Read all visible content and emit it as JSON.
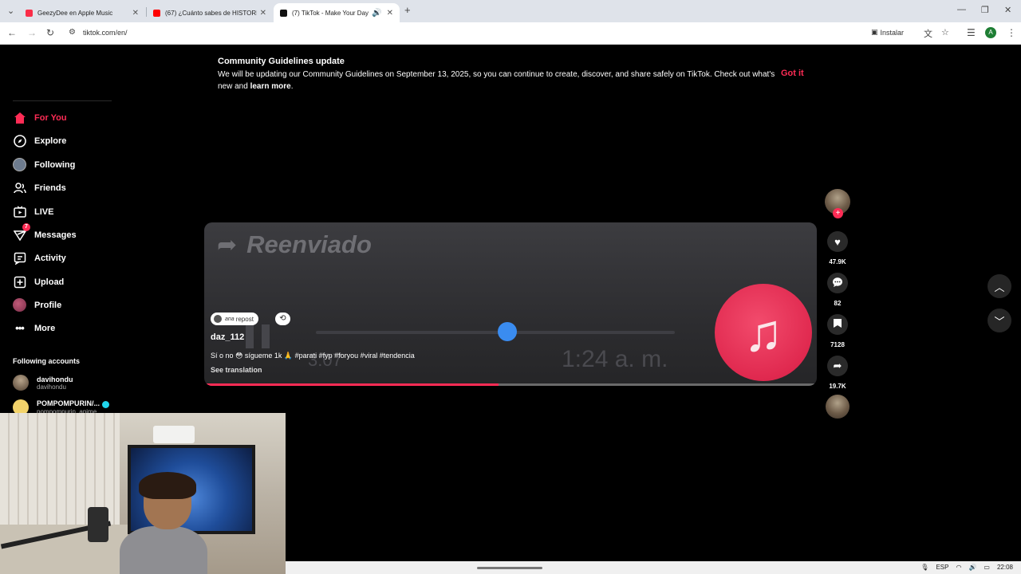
{
  "browser": {
    "tabs": [
      {
        "title": "GeezyDee en Apple Music",
        "favicon_color": "#fa2d48"
      },
      {
        "title": "(67) ¿Cuánto sabes de HISTORIA",
        "favicon_color": "#ff0000"
      },
      {
        "title": "(7) TikTok - Make Your Day",
        "favicon_color": "#111111"
      }
    ],
    "new_tab": "+",
    "url": "tiktok.com/en/",
    "install_label": "Instalar",
    "profile_initial": "A"
  },
  "banner": {
    "title": "Community Guidelines update",
    "body": "We will be updating our Community Guidelines on September 13, 2025, so you can continue to create, discover, and share safely on TikTok. Check out what's new and",
    "link": "learn more",
    "end": ".",
    "action": "Got it"
  },
  "sidebar": {
    "items": [
      {
        "label": "For You",
        "icon": "home-icon",
        "active": true
      },
      {
        "label": "Explore",
        "icon": "compass-icon"
      },
      {
        "label": "Following",
        "icon": "following-avatar-icon"
      },
      {
        "label": "Friends",
        "icon": "friends-icon"
      },
      {
        "label": "LIVE",
        "icon": "live-icon"
      },
      {
        "label": "Messages",
        "icon": "messages-icon",
        "badge": "7"
      },
      {
        "label": "Activity",
        "icon": "activity-icon"
      },
      {
        "label": "Upload",
        "icon": "upload-icon"
      },
      {
        "label": "Profile",
        "icon": "profile-avatar-icon"
      },
      {
        "label": "More",
        "icon": "more-icon"
      }
    ],
    "following_header": "Following accounts",
    "accounts": [
      {
        "name": "davihondu",
        "handle": "davihondu"
      },
      {
        "name": "POMPOMPURIN/...",
        "handle": "pompompurin_anime"
      }
    ]
  },
  "video": {
    "overlay_text": "Reenviado",
    "overlay_time": "1:24 a. m.",
    "overlay_time_small": "3:07",
    "repost_pill": "repost",
    "repost_by": "ana",
    "author": "daz_112",
    "caption": "Sí o no 😳 sígueme 1k 🙏 #parati #fyp #foryou #viral #tendencia",
    "see_translation": "See translation",
    "progress": 0.48
  },
  "actions": {
    "likes": "47.9K",
    "comments": "82",
    "saves": "7128",
    "shares": "19.7K"
  },
  "taskbar": {
    "lang": "ESP",
    "time": "22:08"
  },
  "colors": {
    "accent": "#fe2c55",
    "music_app": "#e0294f",
    "slider": "#3a8cf0"
  }
}
